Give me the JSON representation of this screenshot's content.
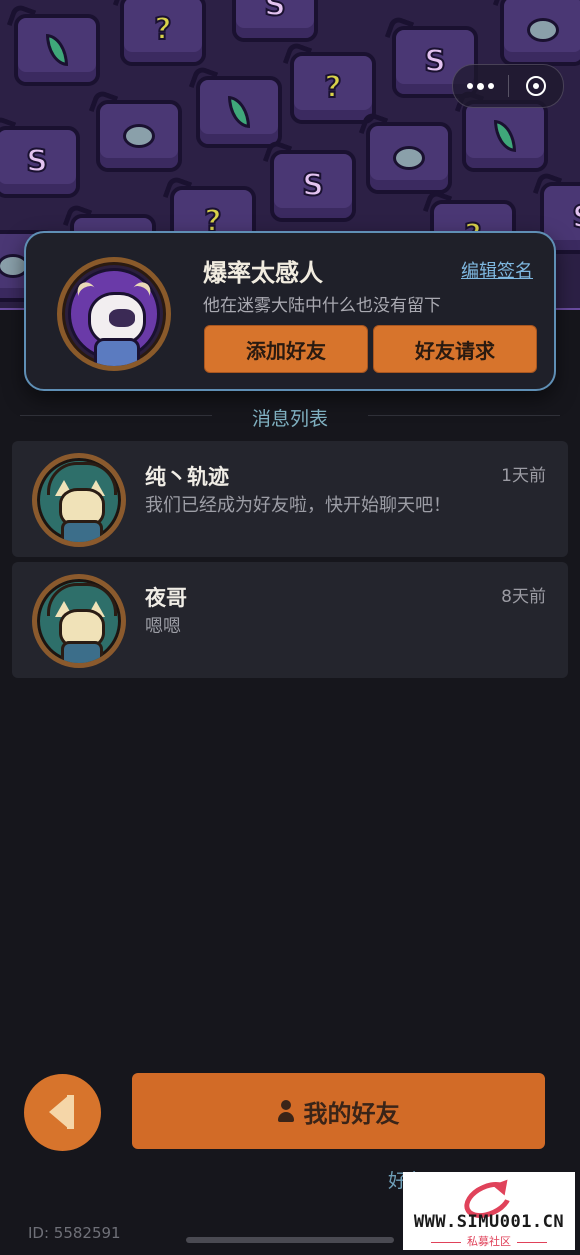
{
  "header": {
    "menu_icon": "more-dots-icon",
    "close_icon": "target-circle-icon"
  },
  "profile": {
    "name": "爆率太感人",
    "edit_signature": "编辑签名",
    "signature": "他在迷雾大陆中什么也没有留下",
    "add_friend": "添加好友",
    "friend_requests": "好友请求"
  },
  "messages": {
    "title": "消息列表",
    "items": [
      {
        "name": "纯丶轨迹",
        "time": "1天前",
        "text": "我们已经成为好友啦，快开始聊天吧！"
      },
      {
        "name": "夜哥",
        "time": "8天前",
        "text": "嗯嗯"
      }
    ]
  },
  "footer": {
    "my_friends": "我的好友",
    "friend_id": "好友ID：",
    "user_id": "ID: 5582591"
  },
  "watermark": {
    "site": "WWW.SIMU001.CN",
    "label": "私募社区"
  },
  "colors": {
    "accent": "#d7742c",
    "banner": "#2c2045",
    "link": "#7fb8e0"
  }
}
